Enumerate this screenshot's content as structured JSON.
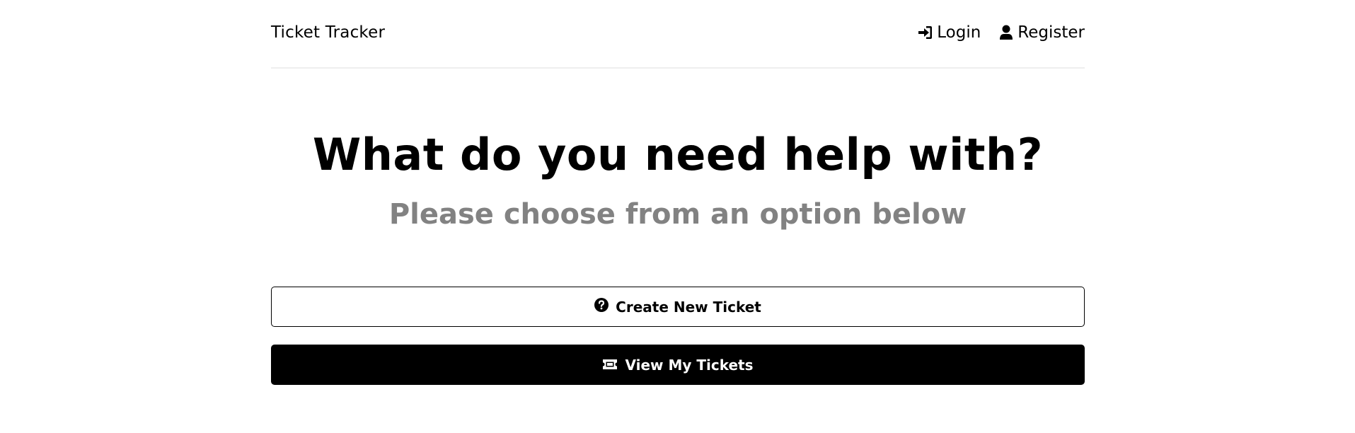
{
  "header": {
    "brand": "Ticket Tracker",
    "nav": [
      {
        "label": "Login",
        "icon": "sign-in-icon"
      },
      {
        "label": "Register",
        "icon": "user-icon"
      }
    ]
  },
  "hero": {
    "title": "What do you need help with?",
    "subtitle": "Please choose from an option below"
  },
  "actions": {
    "create": {
      "label": "Create New Ticket",
      "icon": "question-circle-icon"
    },
    "view": {
      "label": "View My Tickets",
      "icon": "ticket-icon"
    }
  },
  "colors": {
    "primary": "#000000",
    "subtitle": "#828282",
    "background": "#ffffff",
    "divider": "#eeeeee"
  }
}
